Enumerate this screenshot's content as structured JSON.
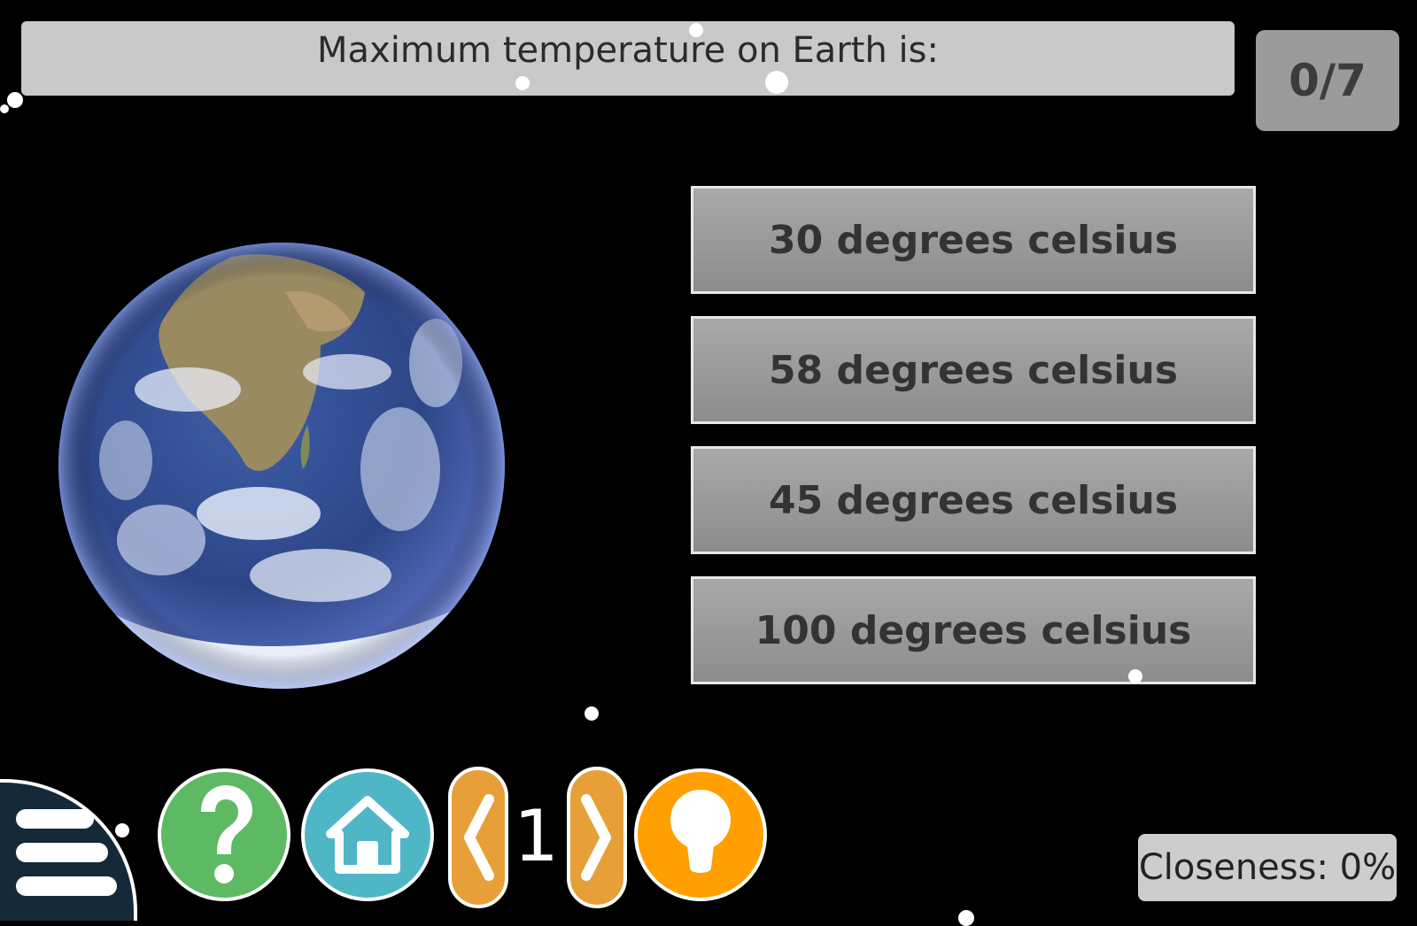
{
  "question": {
    "text": "Maximum temperature on Earth is:"
  },
  "score": {
    "text": "0/7"
  },
  "answers": [
    {
      "label": "30 degrees celsius"
    },
    {
      "label": "58 degrees celsius"
    },
    {
      "label": "45 degrees celsius"
    },
    {
      "label": "100 degrees celsius"
    }
  ],
  "toolbar": {
    "menu_icon": "menu-icon",
    "help_icon": "question-mark-icon",
    "home_icon": "home-icon",
    "prev_icon": "chevron-left-icon",
    "next_icon": "chevron-right-icon",
    "hint_icon": "lightbulb-icon",
    "page_number": "1"
  },
  "closeness": {
    "text": "Closeness: 0%"
  },
  "colors": {
    "background": "#000000",
    "help_button": "#5dba63",
    "home_button": "#4fb6c6",
    "nav_button": "#e6a037",
    "hint_button": "#ff9f00",
    "menu_button": "#152a39"
  }
}
